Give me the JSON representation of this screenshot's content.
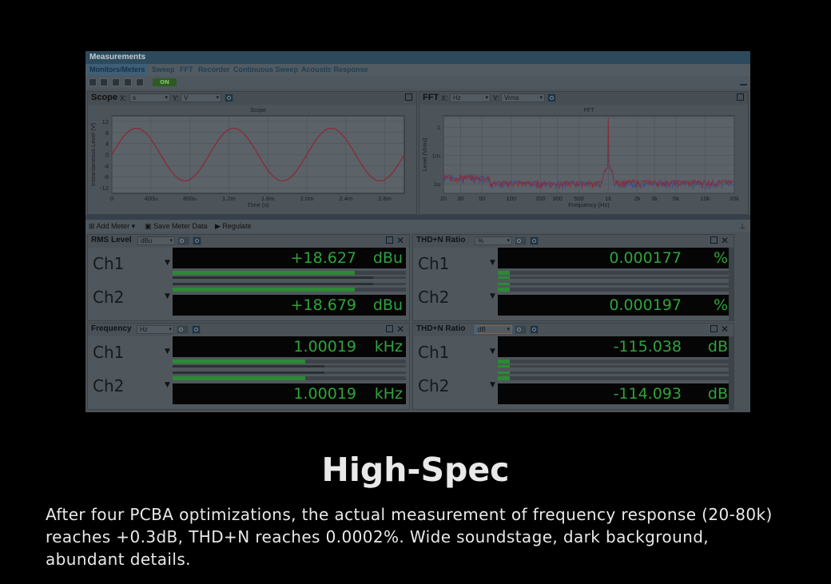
{
  "window": {
    "title": "Measurements"
  },
  "tabs": [
    {
      "label": "Monitors/Meters",
      "active": true
    },
    {
      "label": "Sweep"
    },
    {
      "label": "FFT"
    },
    {
      "label": "Recorder"
    },
    {
      "label": "Continuous Sweep"
    },
    {
      "label": "Acoustic Response"
    }
  ],
  "toolbar": {
    "on_label": "ON"
  },
  "scope": {
    "title": "Scope",
    "x_label": "X:",
    "x_value": "s",
    "y_label": "Y:",
    "y_value": "V"
  },
  "fft": {
    "title": "FFT",
    "x_label": "X:",
    "x_value": "Hz",
    "y_label": "Y:",
    "y_value": "Vrms"
  },
  "meter_toolbar": {
    "add_meter": "Add Meter",
    "save_meter_data": "Save Meter Data",
    "regulate": "Regulate"
  },
  "meters": [
    {
      "title": "RMS Level",
      "unit_select": "dBu",
      "channels": [
        {
          "label": "Ch1",
          "value": "+18.627",
          "unit": "dBu",
          "level": 0.78
        },
        {
          "label": "Ch2",
          "value": "+18.679",
          "unit": "dBu",
          "level": 0.78
        }
      ]
    },
    {
      "title": "THD+N Ratio",
      "unit_select": "%",
      "channels": [
        {
          "label": "Ch1",
          "value": "0.000177",
          "unit": "%",
          "level": 0.05
        },
        {
          "label": "Ch2",
          "value": "0.000197",
          "unit": "%",
          "level": 0.05
        }
      ]
    },
    {
      "title": "Frequency",
      "unit_select": "Hz",
      "channels": [
        {
          "label": "Ch1",
          "value": "1.00019",
          "unit": "kHz",
          "level": 0.57
        },
        {
          "label": "Ch2",
          "value": "1.00019",
          "unit": "kHz",
          "level": 0.57
        }
      ]
    },
    {
      "title": "THD+N Ratio",
      "unit_select": "dB",
      "channels": [
        {
          "label": "Ch1",
          "value": "-115.038",
          "unit": "dB",
          "level": 0.05
        },
        {
          "label": "Ch2",
          "value": "-114.093",
          "unit": "dB",
          "level": 0.05
        }
      ]
    }
  ],
  "chart_data": [
    {
      "type": "line",
      "title": "Scope",
      "xlabel": "Time (s)",
      "ylabel": "Instantaneous Level (V)",
      "x_ticks": [
        "0",
        "400u",
        "800u",
        "1.2m",
        "1.6m",
        "2.0m",
        "2.4m",
        "2.8m"
      ],
      "y_ticks": [
        "12",
        "8",
        "4",
        "0",
        "-4",
        "-8",
        "-12"
      ],
      "xlim": [
        0,
        0.003
      ],
      "ylim": [
        -14,
        14
      ],
      "grid": true,
      "series": [
        {
          "amplitude": 9.5,
          "frequency_hz": 1000,
          "phase_deg": 0,
          "color": "#8c2a35"
        }
      ]
    },
    {
      "type": "line",
      "title": "FFT",
      "xlabel": "Frequency (Hz)",
      "ylabel": "Level (Vrms)",
      "x_ticks": [
        "20",
        "30",
        "50",
        "100",
        "200",
        "300",
        "500",
        "1k",
        "2k",
        "3k",
        "5k",
        "10k",
        "20k"
      ],
      "y_ticks": [
        "1",
        "1m",
        "1u"
      ],
      "xlim": [
        20,
        20000
      ],
      "x_scale": "log",
      "y_scale": "log",
      "grid": true,
      "series": [
        {
          "color": "#3a4f8c",
          "peak_hz": 1000,
          "peak_vrms": 7.7,
          "floor_vrms": 5e-07
        },
        {
          "color": "#8c2a35",
          "peak_hz": 1000,
          "peak_vrms": 7.7,
          "floor_vrms": 5e-07
        }
      ]
    }
  ],
  "caption": {
    "heading": "High-Spec",
    "body": "After four PCBA optimizations, the actual measurement of frequency response (20-80k) reaches +0.3dB, THD+N reaches 0.0002%. Wide soundstage, dark background, abundant details."
  }
}
